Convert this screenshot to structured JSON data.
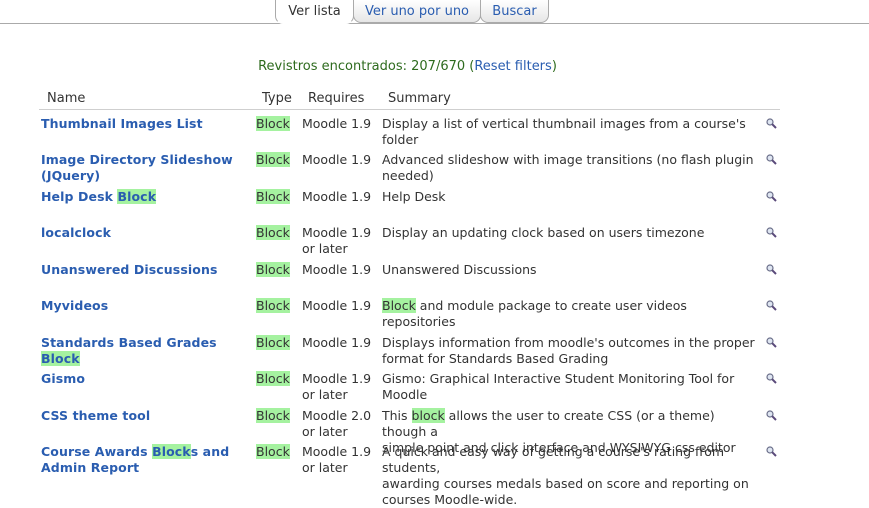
{
  "tabs": [
    "Ver lista",
    "Ver uno por uno",
    "Buscar"
  ],
  "found": {
    "text": "Revistros encontrados: 207/670 (",
    "link": "Reset filters",
    "close": ")"
  },
  "columns": {
    "name": "Name",
    "type": "Type",
    "requires": "Requires",
    "summary": "Summary"
  },
  "highlight_color": "#a5f2a0",
  "link_color": "#2a5db0",
  "rows": [
    {
      "name": [
        "Thumbnail Images List"
      ],
      "type": "Block",
      "requires": [
        "Moodle 1.9"
      ],
      "summary": [
        "Display a list of vertical thumbnail images from a course's folder"
      ],
      "action": "zoom-icon"
    },
    {
      "name": [
        "Image Directory Slideshow",
        "(JQuery)"
      ],
      "type": "Block",
      "requires": [
        "Moodle 1.9"
      ],
      "summary": [
        "Advanced slideshow with image transitions (no flash plugin",
        "needed)"
      ],
      "action": "zoom-icon"
    },
    {
      "name": [
        "Help Desk ",
        "Block"
      ],
      "type": "Block",
      "requires": [
        "Moodle 1.9"
      ],
      "summary": [
        "Help Desk"
      ],
      "action": "zoom-icon"
    },
    {
      "name": [
        "localclock"
      ],
      "type": "Block",
      "requires": [
        "Moodle 1.9",
        "or later"
      ],
      "summary": [
        "Display an updating clock based on users timezone"
      ],
      "action": "zoom-icon"
    },
    {
      "name": [
        "Unanswered Discussions"
      ],
      "type": "Block",
      "requires": [
        "Moodle 1.9"
      ],
      "summary": [
        "Unanswered Discussions"
      ],
      "action": "zoom-icon"
    },
    {
      "name": [
        "Myvideos"
      ],
      "type": "Block",
      "requires": [
        "Moodle 1.9"
      ],
      "summary": [
        "Block",
        " and module package to create user videos repositories"
      ],
      "action": "zoom-icon"
    },
    {
      "name": [
        "Standards Based Grades ",
        "Block"
      ],
      "type": "Block",
      "requires": [
        "Moodle 1.9"
      ],
      "summary": [
        "Displays information from moodle's outcomes in the proper",
        "format for Standards Based Grading"
      ],
      "action": "zoom-icon"
    },
    {
      "name": [
        "Gismo"
      ],
      "type": "Block",
      "requires": [
        "Moodle 1.9",
        "or later"
      ],
      "summary": [
        "Gismo: Graphical Interactive Student Monitoring Tool for Moodle"
      ],
      "action": "zoom-icon"
    },
    {
      "name": [
        "CSS theme tool"
      ],
      "type": "Block",
      "requires": [
        "Moodle 2.0",
        "or later"
      ],
      "summary": [
        "This ",
        "block",
        " allows the user to create CSS (or a theme) though a",
        "simple point and click interface and WYSIWYG css editor"
      ],
      "action": "zoom-icon"
    },
    {
      "name": [
        "Course Awards ",
        "Block",
        "s and",
        "Admin Report"
      ],
      "type": "Block",
      "requires": [
        "Moodle 1.9",
        "or later"
      ],
      "summary": [
        "A quick and easy way of getting a course's rating from students,",
        "awarding courses medals based on score and reporting on",
        "courses Moodle-wide."
      ],
      "action": "zoom-icon"
    }
  ]
}
